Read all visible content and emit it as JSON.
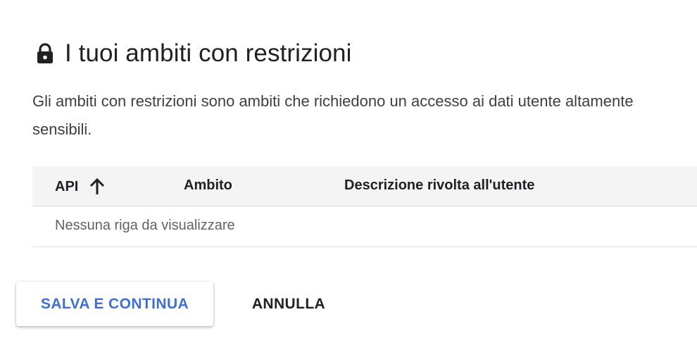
{
  "section": {
    "icon": "lock-icon",
    "title": "I tuoi ambiti con restrizioni",
    "description": "Gli ambiti con restrizioni sono ambiti che richiedono un accesso ai dati utente altamente sensibili."
  },
  "table": {
    "columns": [
      {
        "label": "API",
        "sorted": "ascending",
        "sort_icon": "arrow-up-icon"
      },
      {
        "label": "Ambito"
      },
      {
        "label": "Descrizione rivolta all'utente"
      }
    ],
    "empty_message": "Nessuna riga da visualizzare"
  },
  "actions": {
    "save_label": "SALVA E CONTINUA",
    "cancel_label": "ANNULLA"
  },
  "colors": {
    "primary": "#3f6fd0",
    "header_bg": "#f4f4f4",
    "divider": "#dadce0",
    "text": "#202124"
  }
}
